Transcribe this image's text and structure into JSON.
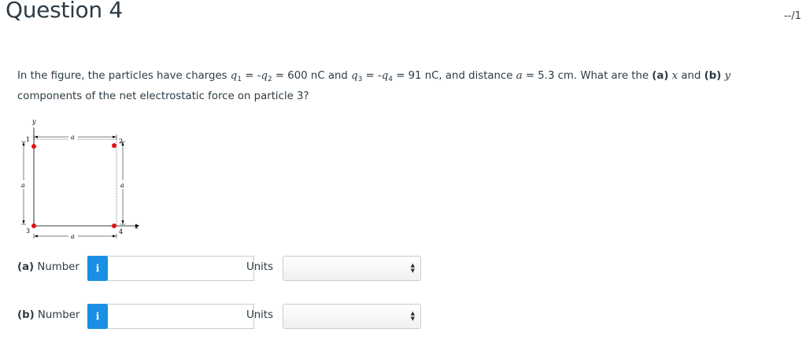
{
  "question": {
    "title": "Question 4",
    "score": "--/1",
    "text": {
      "p1": "In the figure, the particles have charges ",
      "q1": "q",
      "q1_sub": "1",
      "p2": " = -",
      "q2": "q",
      "q2_sub": "2",
      "p3": " = 600 nC and ",
      "q3": "q",
      "q3_sub": "3",
      "p4": " = -",
      "q4": "q",
      "q4_sub": "4",
      "p5": " = 91 nC, and distance ",
      "a": "a",
      "p6": " = 5.3 cm. What are the ",
      "part_a": "(a)",
      "x": "x",
      "p7": " and ",
      "part_b": "(b)",
      "y": "y",
      "p8": " components of the net electrostatic force on particle 3?"
    }
  },
  "figure": {
    "y_axis_label": "y",
    "x_axis_label": "x",
    "dist_top": "a",
    "dist_bottom": "a",
    "dist_left": "a",
    "dist_right": "a",
    "particle_1": "1",
    "particle_2": "2",
    "particle_3": "3",
    "particle_4": "4",
    "particle_color": "#e01010"
  },
  "answers": [
    {
      "part": "(a)",
      "label": "Number",
      "info_icon": "i",
      "value": "",
      "units_label": "Units",
      "units_value": ""
    },
    {
      "part": "(b)",
      "label": "Number",
      "info_icon": "i",
      "value": "",
      "units_label": "Units",
      "units_value": ""
    }
  ],
  "colors": {
    "info_button": "#1a8fe3",
    "text": "#2d3b45",
    "border": "#c7cdd1"
  }
}
